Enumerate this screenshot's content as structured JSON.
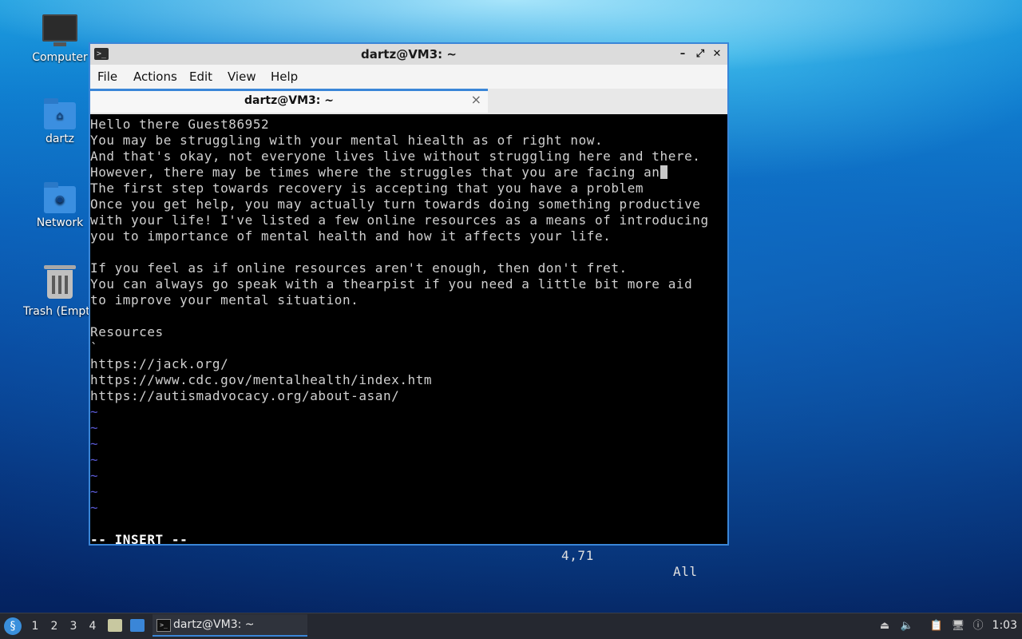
{
  "desktop": {
    "icons": [
      {
        "label": "Computer",
        "icon": "computer-icon"
      },
      {
        "label": "dartz",
        "icon": "home-folder-icon"
      },
      {
        "label": "Network",
        "icon": "network-folder-icon"
      },
      {
        "label": "Trash (Empty)",
        "icon": "trash-icon"
      }
    ]
  },
  "window": {
    "title": "dartz@VM3: ~",
    "menu": [
      "File",
      "Actions",
      "Edit",
      "View",
      "Help"
    ],
    "tab_label": "dartz@VM3: ~",
    "tab_close": "×",
    "controls": {
      "minimize": "–",
      "maximize": "⤢",
      "close": "✕"
    }
  },
  "terminal": {
    "lines": [
      "Hello there Guest86952",
      "You may be struggling with your mental hiealth as of right now.",
      "And that's okay, not everyone lives live without struggling here and there.",
      "However, there may be times where the struggles that you are facing an",
      "The first step towards recovery is accepting that you have a problem",
      "Once you get help, you may actually turn towards doing something productive",
      "with your life! I've listed a few online resources as a means of introducing",
      "you to importance of mental health and how it affects your life.",
      "",
      "If you feel as if online resources aren't enough, then don't fret.",
      "You can always go speak with a thearpist if you need a little bit more aid",
      "to improve your mental situation.",
      "",
      "Resources",
      "`",
      "https://jack.org/",
      "https://www.cdc.gov/mentalhealth/index.htm",
      "https://autismadvocacy.org/about-asan/",
      "~",
      "~",
      "~",
      "~",
      "~",
      "~",
      "~"
    ],
    "status_mode": "-- INSERT --",
    "status_position": "4,71",
    "status_percent": "All"
  },
  "taskbar": {
    "workspaces": [
      "1",
      "2",
      "3",
      "4"
    ],
    "active_workspace": "1",
    "task_label": "dartz@VM3: ~",
    "clock": "1:03"
  },
  "colors": {
    "window_border": "#3a86d8",
    "terminal_bg": "#000000",
    "terminal_fg": "#d0d0d0",
    "tilde": "#5a5ad6",
    "taskbar_bg": "#252830"
  }
}
